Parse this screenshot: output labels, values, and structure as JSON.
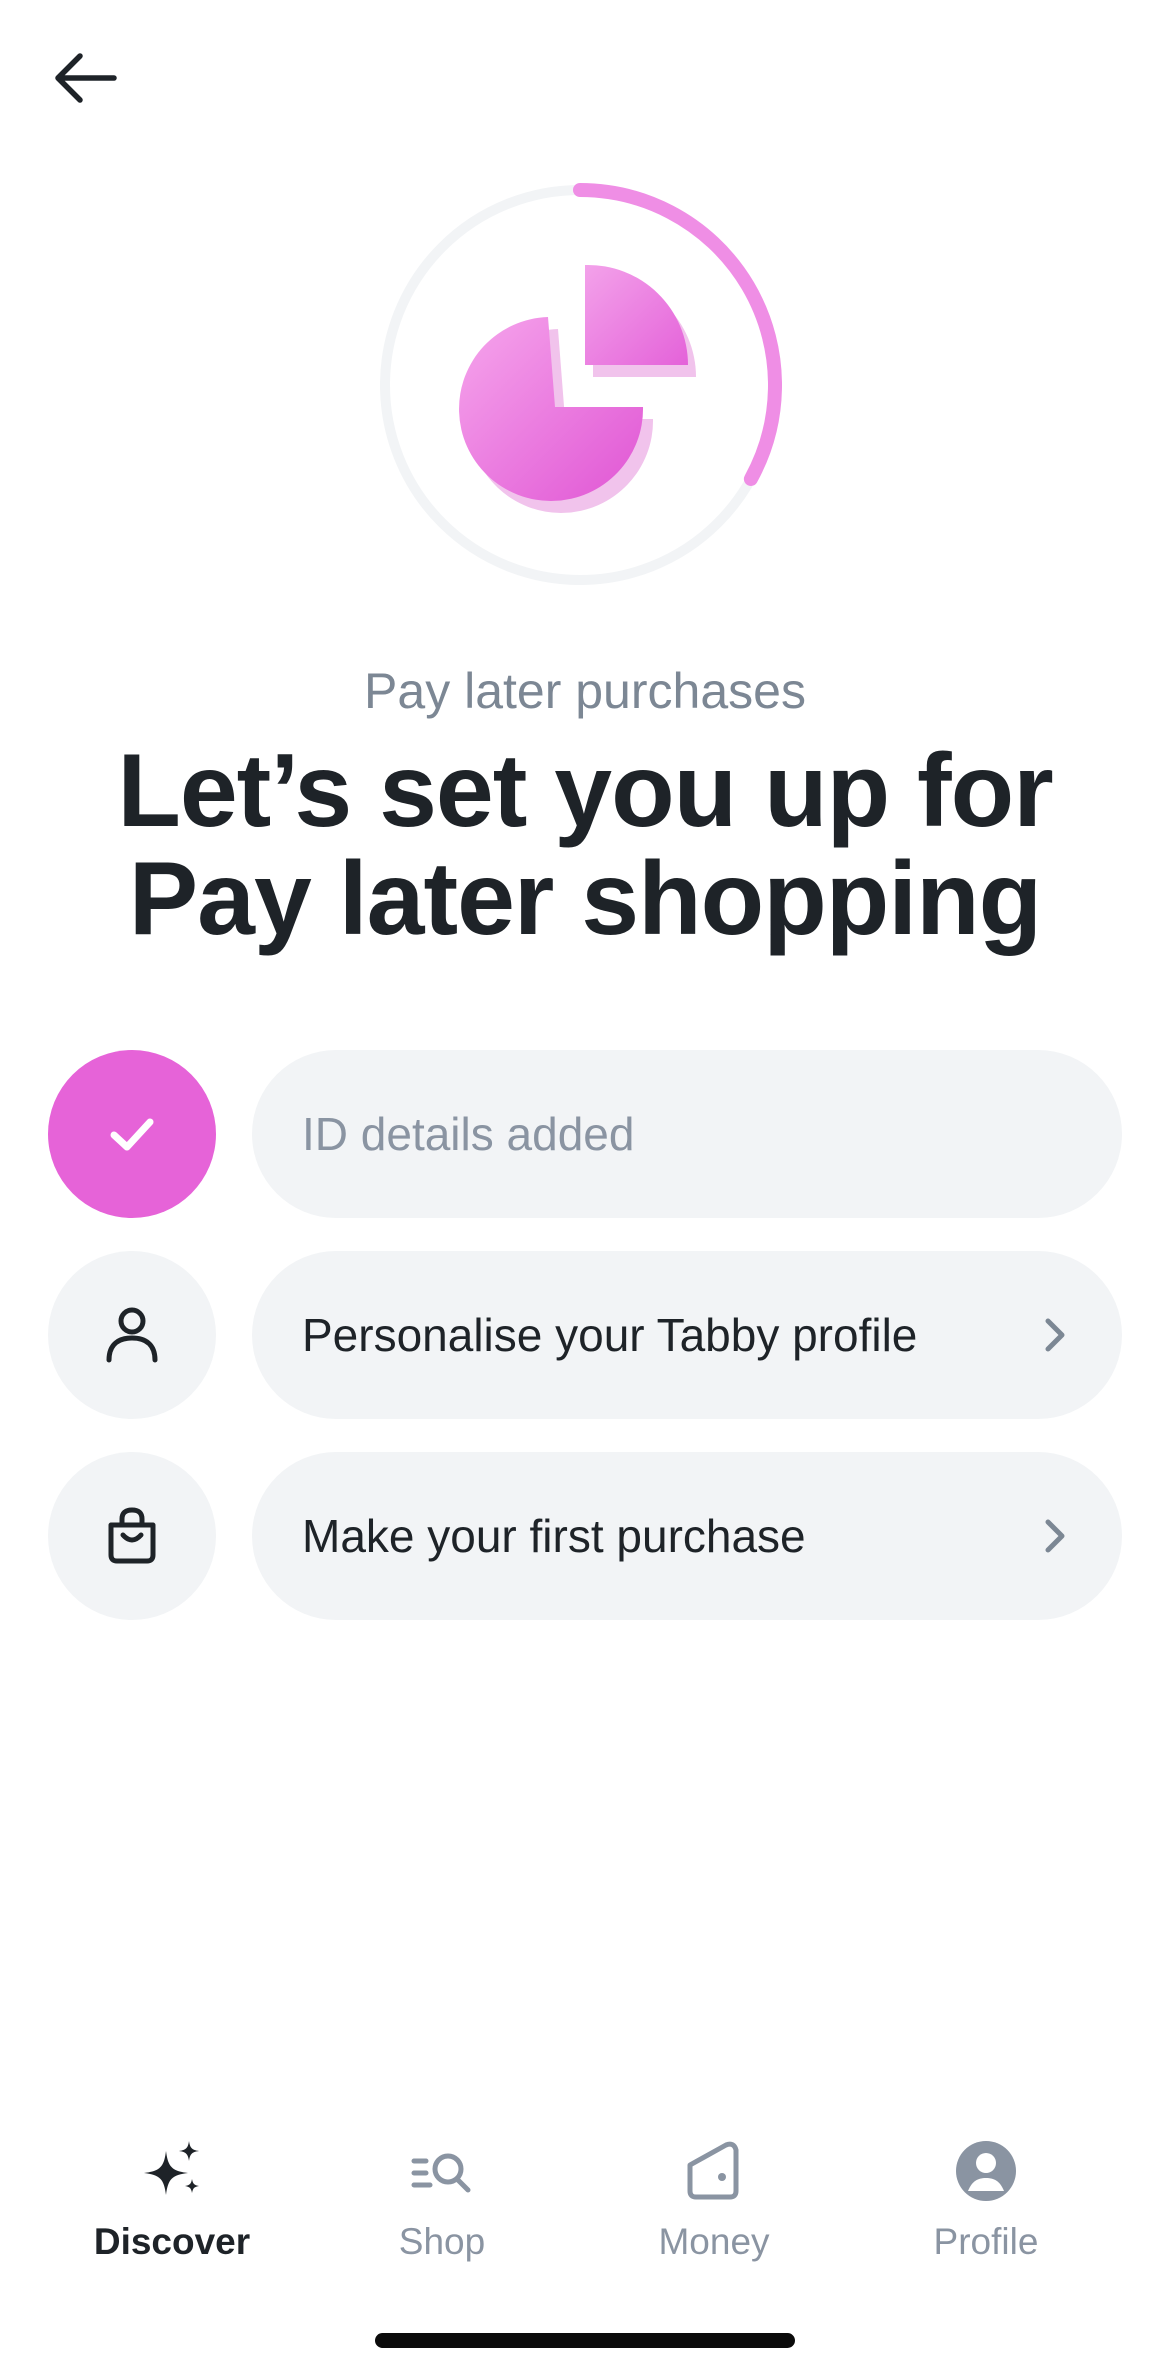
{
  "header": {
    "back_icon": "arrow-left-icon"
  },
  "hero": {
    "illustration": "pie-chart-3d-icon",
    "progress": 0.33,
    "accent_color": "#e663d8",
    "track_color": "#f2f4f6"
  },
  "subtitle": "Pay later purchases",
  "headline": "Let’s set you up for Pay later shopping",
  "steps": [
    {
      "label": "ID details added",
      "status": "completed",
      "icon": "check-icon"
    },
    {
      "label": "Personalise your Tabby profile",
      "status": "pending",
      "icon": "person-icon"
    },
    {
      "label": "Make your first purchase",
      "status": "pending",
      "icon": "shopping-bag-icon"
    }
  ],
  "tabbar": {
    "active": "Discover",
    "tabs": [
      {
        "label": "Discover",
        "icon": "sparkle-icon"
      },
      {
        "label": "Shop",
        "icon": "list-search-icon"
      },
      {
        "label": "Money",
        "icon": "wallet-icon"
      },
      {
        "label": "Profile",
        "icon": "profile-circle-icon"
      }
    ]
  },
  "colors": {
    "accent": "#e663d8",
    "text_primary": "#1e2328",
    "text_muted": "#8a94a2",
    "pill_background": "#f2f4f6"
  }
}
